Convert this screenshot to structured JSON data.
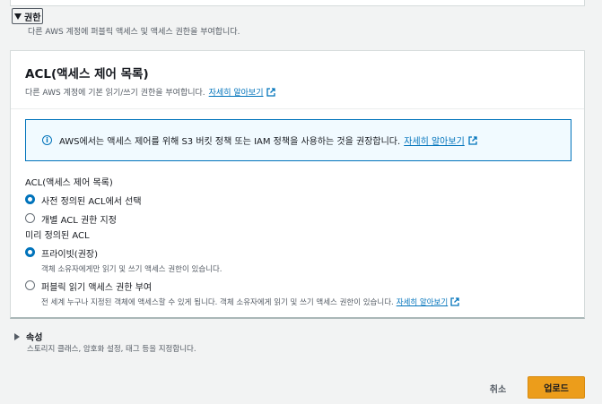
{
  "permissions": {
    "toggle_label": "권한",
    "description": "다른 AWS 계정에 퍼블릭 액세스 및 액세스 권한을 부여합니다."
  },
  "acl_panel": {
    "title": "ACL(액세스 제어 목록)",
    "description": "다른 AWS 계정에 기본 읽기/쓰기 권한을 부여합니다.",
    "learn_more": "자세히 알아보기",
    "info_text": "AWS에서는 액세스 제어를 위해 S3 버킷 정책 또는 IAM 정책을 사용하는 것을 권장합니다.",
    "info_link": "자세히 알아보기",
    "acl_label": "ACL(액세스 제어 목록)",
    "acl_options": [
      {
        "label": "사전 정의된 ACL에서 선택",
        "selected": true
      },
      {
        "label": "개별 ACL 권한 지정",
        "selected": false
      }
    ],
    "predefined_label": "미리 정의된 ACL",
    "predefined_options": [
      {
        "label": "프라이빗(권장)",
        "description": "객체 소유자에게만 읽기 및 쓰기 액세스 권한이 있습니다.",
        "selected": true
      },
      {
        "label": "퍼블릭 읽기 액세스 권한 부여",
        "description": "전 세계 누구나 지정된 객체에 액세스할 수 있게 됩니다. 객체 소유자에게 읽기 및 쓰기 액세스 권한이 있습니다.",
        "link": "자세히 알아보기",
        "selected": false
      }
    ]
  },
  "properties": {
    "title": "속성",
    "description": "스토리지 클래스, 암호화 설정, 태그 등을 지정합니다."
  },
  "footer": {
    "cancel_label": "취소",
    "upload_label": "업로드"
  },
  "colors": {
    "accent": "#0073bb",
    "primary_button": "#ec9d1b",
    "background": "#f2f3f3"
  }
}
